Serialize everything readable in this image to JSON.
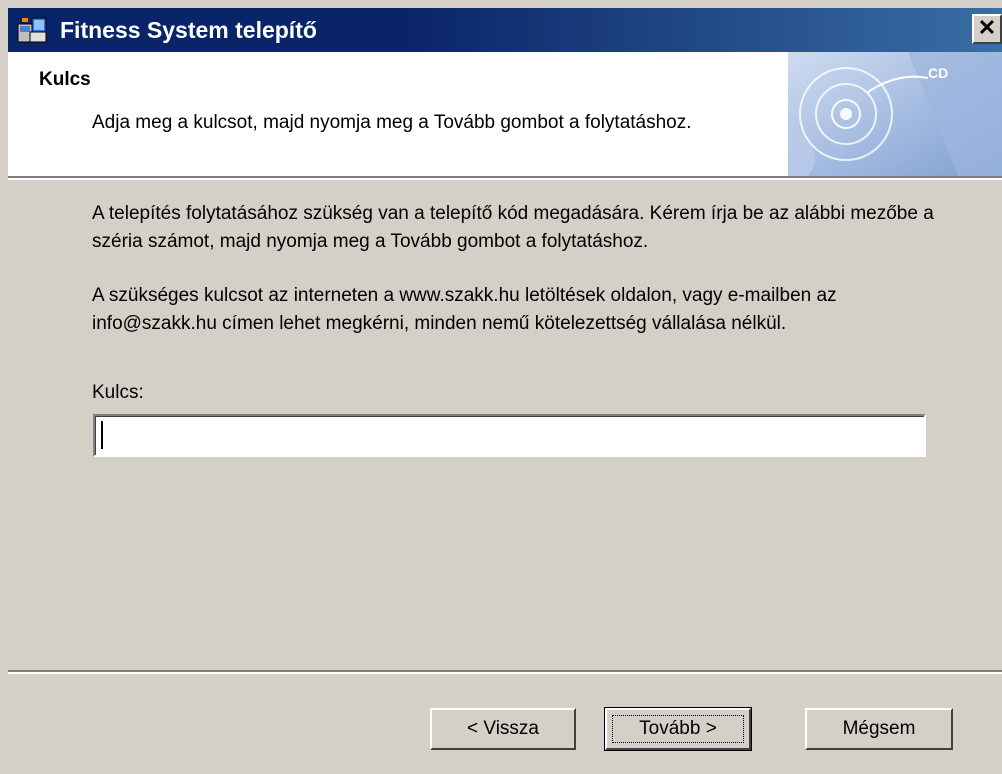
{
  "window": {
    "title": "Fitness System telepítő",
    "close_glyph": "✕"
  },
  "header": {
    "title": "Kulcs",
    "subtitle": "Adja meg a kulcsot, majd nyomja meg a Tovább gombot a folytatáshoz.",
    "graphic_label": "CD"
  },
  "body": {
    "paragraph1": "A telepítés folytatásához szükség van a telepítő kód megadására. Kérem írja be az alábbi mezőbe a széria számot, majd nyomja meg a Tovább gombot a folytatáshoz.",
    "paragraph2": "A szükséges kulcsot az interneten a www.szakk.hu letöltések oldalon, vagy e-mailben az info@szakk.hu címen lehet megkérni, minden nemű kötelezettség vállalása nélkül.",
    "key_label": "Kulcs:",
    "key_value": ""
  },
  "buttons": {
    "back": "< Vissza",
    "next": "Tovább >",
    "cancel": "Mégsem"
  },
  "colors": {
    "titlebar": "#0a246a",
    "face": "#d4d0c8"
  }
}
